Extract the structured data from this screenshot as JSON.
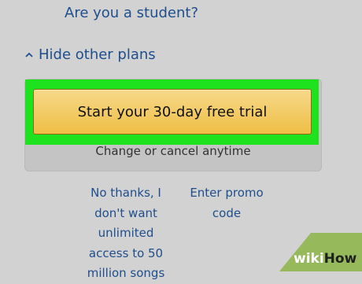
{
  "links": {
    "student": "Are you a student?",
    "hide_plans": "Hide other plans",
    "no_thanks_lines": [
      "No thanks, I",
      "don't want",
      "unlimited",
      "access to 50",
      "million songs"
    ],
    "promo_lines": [
      "Enter promo",
      "code"
    ]
  },
  "plan": {
    "cta_label": "Start your 30-day free trial",
    "note": "Change or cancel anytime"
  },
  "watermark": {
    "part1": "wiki",
    "part2": "How"
  },
  "icons": {
    "hide_plans": "chevron-up-icon"
  },
  "colors": {
    "background": "#d2d2d2",
    "link": "#1f4e8c",
    "highlight": "#1ee21e",
    "button_top": "#f6d98a",
    "button_bottom": "#efbe45",
    "watermark_green": "#96ba5b"
  }
}
